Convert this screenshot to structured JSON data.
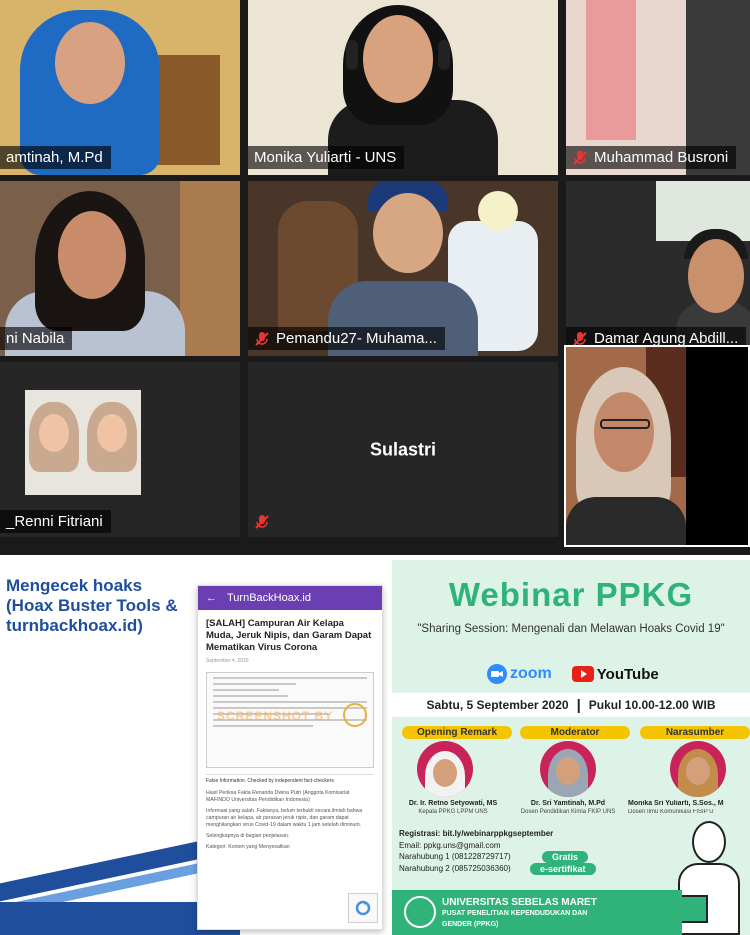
{
  "participants": [
    {
      "name": "amtinah, M.Pd",
      "muted": false
    },
    {
      "name": "Monika Yuliarti - UNS",
      "muted": false
    },
    {
      "name": "Muhammad Busroni",
      "muted": true
    },
    {
      "name": "ni Nabila",
      "muted": false
    },
    {
      "name": "Pemandu27- Muhama...",
      "muted": true
    },
    {
      "name": "Damar Agung Abdill...",
      "muted": true
    },
    {
      "name": "_Renni Fitriani",
      "muted": false
    },
    {
      "name": "Sulastri",
      "muted": true
    }
  ],
  "slide_left": {
    "title_line1": "Mengecek hoaks",
    "title_line2": "(Hoax Buster Tools &",
    "title_line3": "turnbackhoax.id)",
    "app_bar_title": "TurnBackHoax.id",
    "article_title": "[SALAH] Campuran Air Kelapa Muda, Jeruk Nipis, dan Garam Dapat Mematikan Virus Corona",
    "article_meta": "September 4, 2020",
    "watermark": "SCREENSHOT BY",
    "false_info": "False Information. Checked by independent fact-checkers",
    "para1": "Hasil Periksa Fakta Renanda Dwina Putri (Anggota Komisariat MAFINDO Universitas Pendidikan Indonesia)",
    "para2": "Informasi yang salah. Faktanya, belum terbukti secara ilmiah bahwa campuran air kelapa, air perasan jeruk nipis, dan garam dapat menghilangkan virus Covid-19 dalam waktu 1 jam setelah diminum.",
    "para3": "Selengkapnya di bagian penjelasan.",
    "para4": "Kategori: Konten yang Menyesatkan"
  },
  "poster": {
    "title": "Webinar PPKG",
    "subtitle": "\"Sharing Session: Mengenali dan Melawan Hoaks Covid 19\"",
    "zoom_label": "zoom",
    "youtube_label": "YouTube",
    "date": "Sabtu, 5 September 2020",
    "separator": "|",
    "time": "Pukul 10.00-12.00 WIB",
    "roles": [
      "Opening Remark",
      "Moderator",
      "Narasumber"
    ],
    "speakers": [
      {
        "name": "Dr. Ir. Retno Setyowati, MS",
        "role": "Kepala PPKG LPPM UNS"
      },
      {
        "name": "Dr. Sri Yamtinah, M.Pd",
        "role": "Dosen Pendidikan Kimia FKIP UNS"
      },
      {
        "name": "Monika Sri Yuliarti, S.Sos., M",
        "role": "Dosen Ilmu Komunikasi FISIP U"
      }
    ],
    "registration": "Registrasi: bit.ly/webinarppkgseptember",
    "email": "Email: ppkg.uns@gmail.com",
    "contact1": "Narahubung 1 (081228729717)",
    "contact2": "Narahubung 2 (085725036360)",
    "badge_free": "Gratis",
    "badge_cert": "e-sertifikat",
    "university": "UNIVERSITAS SEBELAS MARET",
    "center_line1": "PUSAT PENELITIAN KEPENDUDUKAN DAN",
    "center_line2": "GENDER (PPKG)"
  },
  "colors": {
    "zoom_bg": "#1a1a1a",
    "slide_blue": "#1f4e9c",
    "phone_purple": "#6b3fb3",
    "poster_green": "#2fb37a",
    "poster_bg": "#ddf3e8",
    "pill_yellow": "#f5c400"
  }
}
